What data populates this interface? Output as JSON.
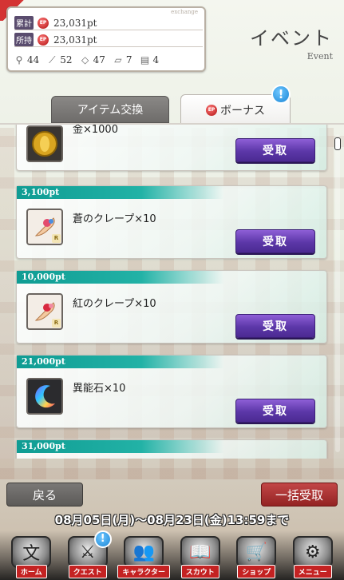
{
  "header": {
    "exchange_tag": "exchange",
    "total_label": "累計",
    "total_value": "23,031pt",
    "owned_label": "所持",
    "owned_value": "23,031pt",
    "ep_badge": "EP",
    "items": [
      {
        "icon": "magnifier-icon",
        "count": "44"
      },
      {
        "icon": "broom-icon",
        "count": "52"
      },
      {
        "icon": "candy-icon",
        "count": "47"
      },
      {
        "icon": "scroll-icon",
        "count": "7"
      },
      {
        "icon": "jar-icon",
        "count": "4"
      }
    ],
    "title": "イベント",
    "subtitle": "Event"
  },
  "tabs": {
    "items_label": "アイテム交換",
    "bonus_label": "ボーナス",
    "bonus_badge": "!"
  },
  "rewards": [
    {
      "threshold": "",
      "name": "金×1000",
      "button": "受取",
      "icon": "gold-coin-icon",
      "rarity": ""
    },
    {
      "threshold": "3,100pt",
      "name": "蒼のクレープ×10",
      "button": "受取",
      "icon": "crepe-icon",
      "rarity": "R"
    },
    {
      "threshold": "10,000pt",
      "name": "紅のクレープ×10",
      "button": "受取",
      "icon": "crepe-icon",
      "rarity": "R"
    },
    {
      "threshold": "21,000pt",
      "name": "異能石×10",
      "button": "受取",
      "icon": "rainbow-crescent-icon",
      "rarity": ""
    },
    {
      "threshold": "31,000pt",
      "name": "",
      "button": "",
      "icon": "",
      "rarity": ""
    }
  ],
  "footer": {
    "back_label": "戻る",
    "claim_all_label": "一括受取",
    "period": "08月05日(月)〜08月23日(金)13:59まで"
  },
  "nav": [
    {
      "label": "ホーム",
      "icon": "book-home-icon",
      "glyph": "文"
    },
    {
      "label": "クエスト",
      "icon": "quest-icon",
      "glyph": "⚔",
      "badge": "!"
    },
    {
      "label": "キャラクター",
      "icon": "characters-icon",
      "glyph": "👥"
    },
    {
      "label": "スカウト",
      "icon": "scout-book-icon",
      "glyph": "📖"
    },
    {
      "label": "ショップ",
      "icon": "shop-cart-icon",
      "glyph": "🛒"
    },
    {
      "label": "メニュー",
      "icon": "gears-icon",
      "glyph": "⚙"
    }
  ],
  "colors": {
    "accent_teal": "#14a096",
    "claim_purple": "#5c37a8",
    "claim_all_red": "#932323",
    "nav_label_red": "#c42222"
  }
}
